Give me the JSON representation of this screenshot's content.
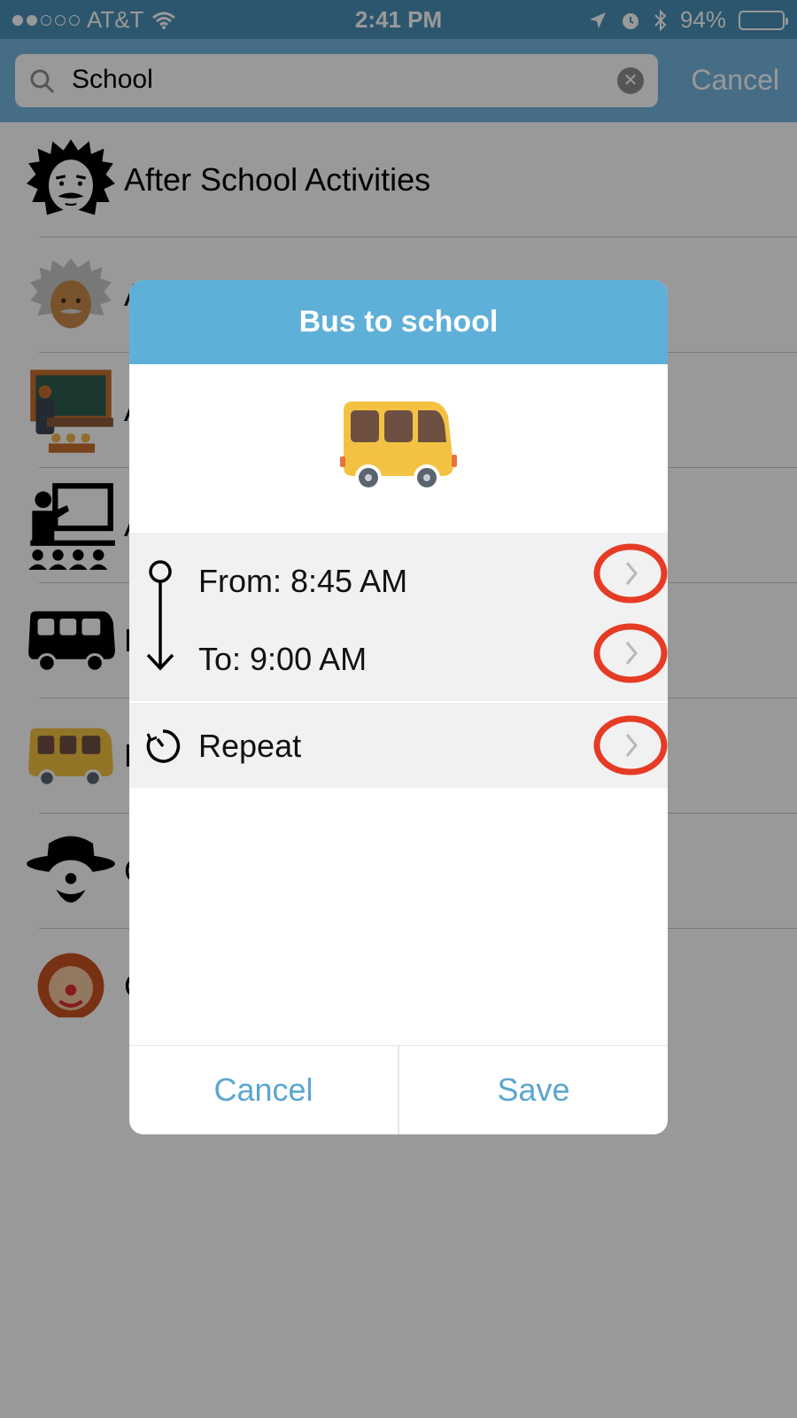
{
  "status_bar": {
    "carrier": "AT&T",
    "time": "2:41 PM",
    "battery": "94%",
    "battery_level": 0.94
  },
  "search": {
    "query": "School",
    "cancel_label": "Cancel"
  },
  "list": {
    "items": [
      {
        "label": "After School Activities",
        "icon": "einstein-silhouette-icon"
      },
      {
        "label": "A",
        "icon": "einstein-color-icon"
      },
      {
        "label": "A",
        "icon": "teacher-classroom-color-icon"
      },
      {
        "label": "A",
        "icon": "teacher-classroom-silhouette-icon"
      },
      {
        "label": "B",
        "icon": "bus-silhouette-icon"
      },
      {
        "label": "B",
        "icon": "bus-color-icon"
      },
      {
        "label": "C",
        "icon": "clown-silhouette-icon"
      },
      {
        "label": "C",
        "icon": "clown-color-icon"
      }
    ]
  },
  "modal": {
    "title": "Bus to school",
    "icon": "school-bus-icon",
    "from_label": "From: 8:45 AM",
    "to_label": "To: 9:00 AM",
    "repeat_label": "Repeat",
    "cancel_label": "Cancel",
    "save_label": "Save",
    "colors": {
      "header": "#5fb0d8",
      "accent": "#5aa6d0",
      "highlight": "#e63b24",
      "bus": "#f4c242"
    }
  }
}
